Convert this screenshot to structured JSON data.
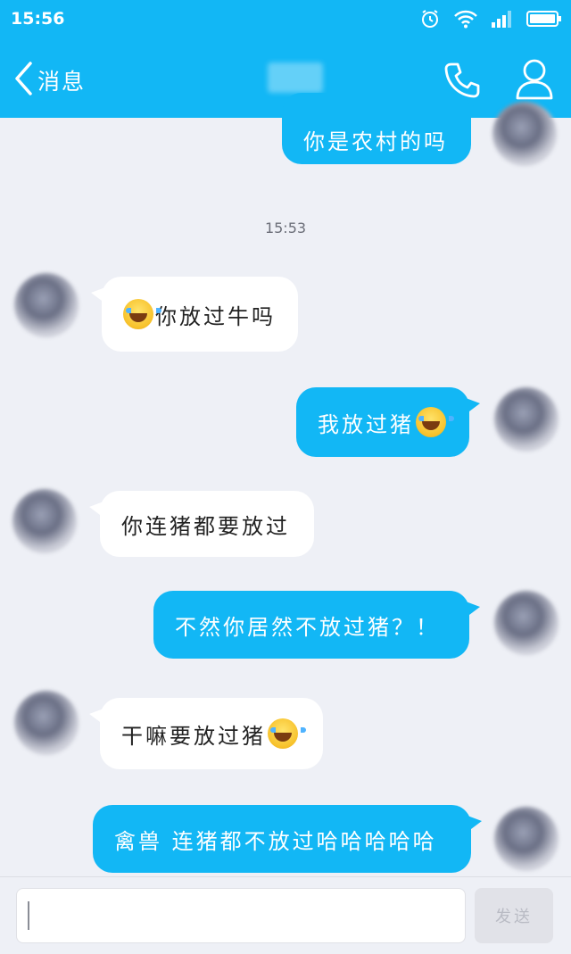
{
  "status_bar": {
    "time": "15:56"
  },
  "nav": {
    "back_label": "消息"
  },
  "messages": {
    "m0": {
      "text": "你是农村的吗"
    },
    "timestamp": "15:53",
    "m1": {
      "text": "你放过牛吗"
    },
    "m2": {
      "text": "我放过猪"
    },
    "m3": {
      "text": "你连猪都要放过"
    },
    "m4": {
      "text": "不然你居然不放过猪？！"
    },
    "m5": {
      "text": "干嘛要放过猪"
    },
    "m6": {
      "text": "禽兽 连猪都不放过哈哈哈哈哈"
    }
  },
  "emoji": {
    "name": "tears-of-joy-emoji"
  },
  "input": {
    "send_label": "发送"
  },
  "colors": {
    "accent": "#12b7f5",
    "background": "#eef0f6",
    "bubble_received": "#ffffff"
  }
}
